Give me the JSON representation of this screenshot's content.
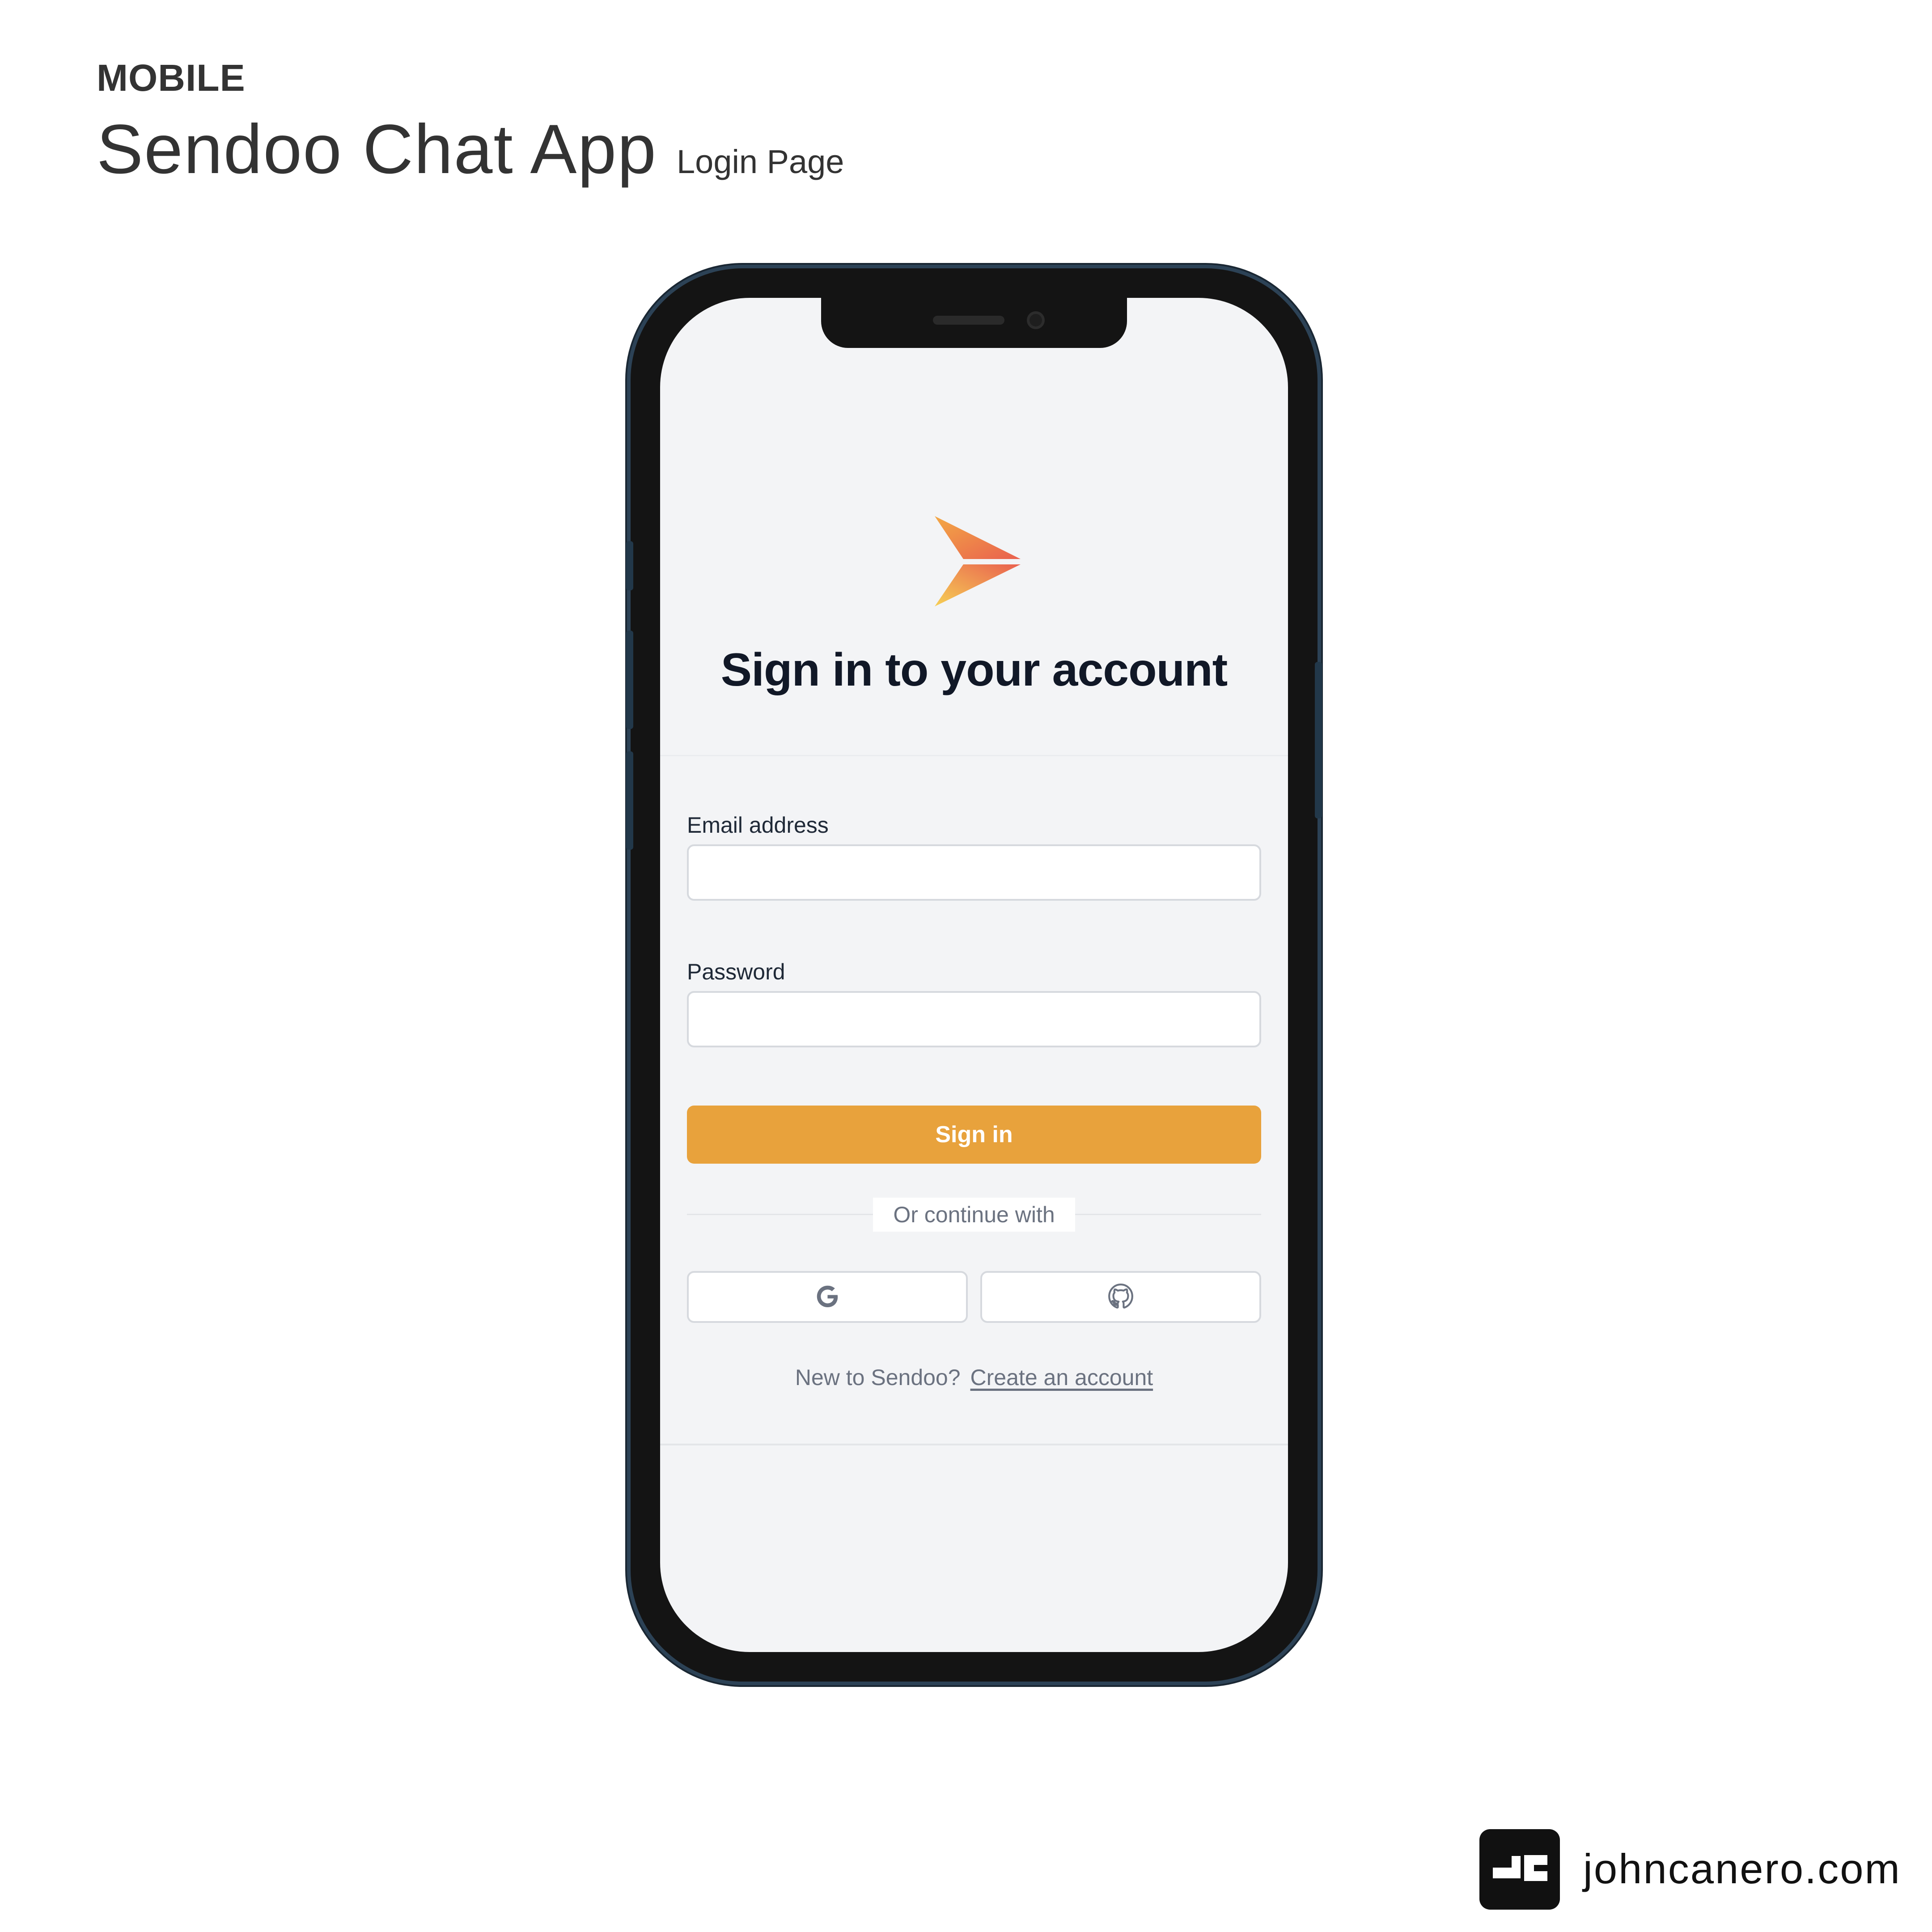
{
  "header": {
    "category": "MOBILE",
    "title": "Sendoo Chat App",
    "subtitle": "Login Page"
  },
  "login": {
    "heading": "Sign in to your account",
    "email_label": "Email address",
    "email_value": "",
    "password_label": "Password",
    "password_value": "",
    "submit_label": "Sign in",
    "divider_text": "Or continue with",
    "social": [
      {
        "icon": "google-icon"
      },
      {
        "icon": "github-icon"
      }
    ],
    "signup_prompt": "New to Sendoo?",
    "signup_link": "Create an account"
  },
  "brand": {
    "site": "johncanero.com",
    "logo_icon": "jc-logo-icon"
  },
  "colors": {
    "accent": "#E8A23C",
    "screen_bg": "#F3F4F6",
    "heading": "#111827",
    "muted": "#6B7280"
  }
}
